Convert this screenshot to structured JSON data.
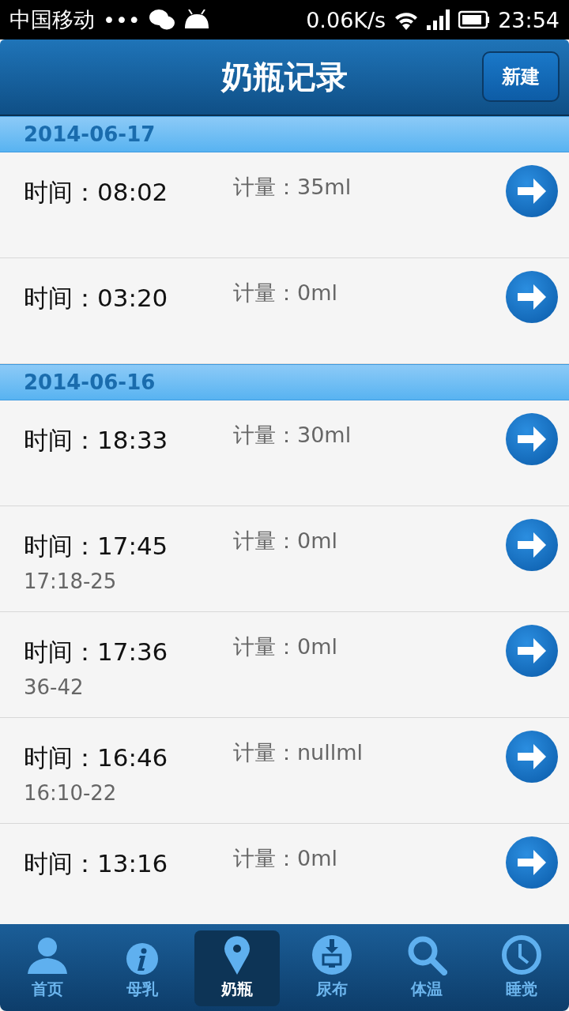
{
  "status_bar": {
    "carrier": "中国移动",
    "dots": "•••",
    "speed": "0.06K/s",
    "time": "23:54"
  },
  "header": {
    "title": "奶瓶记录",
    "new_button": "新建"
  },
  "groups": [
    {
      "date": "2014-06-17",
      "records": [
        {
          "time": "时间：08:02",
          "amount": "计量：35ml"
        },
        {
          "time": "时间：03:20",
          "amount": "计量：0ml"
        }
      ]
    },
    {
      "date": "2014-06-16",
      "records": [
        {
          "time": "时间：18:33",
          "amount": "计量：30ml"
        },
        {
          "time": "时间：17:45",
          "note": "17:18-25",
          "amount": "计量：0ml"
        },
        {
          "time": "时间：17:36",
          "note": "36-42",
          "amount": "计量：0ml"
        },
        {
          "time": "时间：16:46",
          "note": "16:10-22",
          "amount": "计量：nullml"
        },
        {
          "time": "时间：13:16",
          "amount": "计量：0ml"
        }
      ]
    }
  ],
  "tabs": [
    {
      "label": "首页",
      "kind": "person",
      "selected": false
    },
    {
      "label": "母乳",
      "kind": "info",
      "selected": false
    },
    {
      "label": "奶瓶",
      "kind": "pin",
      "selected": true
    },
    {
      "label": "尿布",
      "kind": "monitor",
      "selected": false
    },
    {
      "label": "体温",
      "kind": "search",
      "selected": false
    },
    {
      "label": "睡觉",
      "kind": "clock",
      "selected": false
    }
  ]
}
